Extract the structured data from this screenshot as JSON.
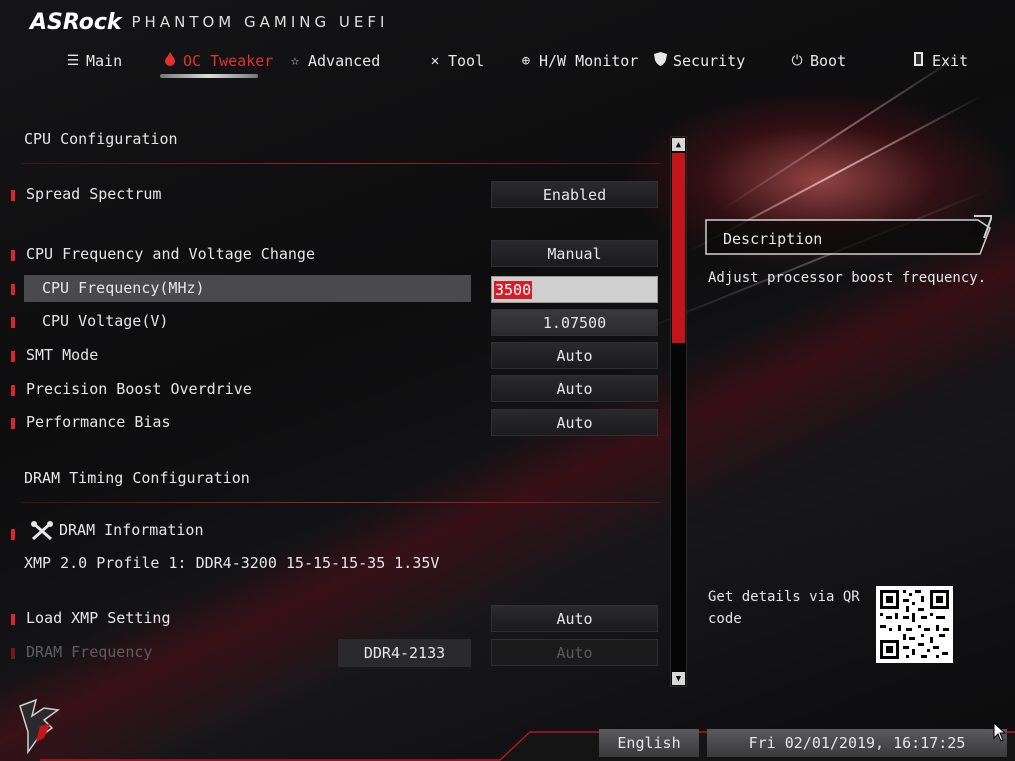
{
  "header": {
    "brand": "ASRock",
    "subtitle": "PHANTOM GAMING UEFI"
  },
  "nav": {
    "tabs": [
      {
        "label": "Main",
        "icon": "list-icon"
      },
      {
        "label": "OC Tweaker",
        "icon": "flame-icon",
        "active": true
      },
      {
        "label": "Advanced",
        "icon": "star-icon"
      },
      {
        "label": "Tool",
        "icon": "tools-icon"
      },
      {
        "label": "H/W Monitor",
        "icon": "crosshair-icon"
      },
      {
        "label": "Security",
        "icon": "shield-icon"
      },
      {
        "label": "Boot",
        "icon": "power-icon"
      },
      {
        "label": "Exit",
        "icon": "exit-door-icon"
      }
    ]
  },
  "cpu_section": {
    "title": "CPU Configuration",
    "rows": [
      {
        "label": "Spread Spectrum",
        "value": "Enabled"
      },
      {
        "label": "CPU Frequency and Voltage Change",
        "value": "Manual"
      },
      {
        "label": "CPU Frequency(MHz)",
        "value": "3500"
      },
      {
        "label": "CPU Voltage(V)",
        "value": "1.07500"
      },
      {
        "label": "SMT Mode",
        "value": "Auto"
      },
      {
        "label": "Precision Boost Overdrive",
        "value": "Auto"
      },
      {
        "label": "Performance Bias",
        "value": "Auto"
      }
    ]
  },
  "dram_section": {
    "title": "DRAM Timing Configuration",
    "info_label": "DRAM Information",
    "xmp_info": "XMP 2.0 Profile 1: DDR4-3200 15-15-15-35 1.35V",
    "load_xmp": {
      "label": "Load XMP Setting",
      "value": "Auto"
    },
    "dram_freq": {
      "label": "DRAM Frequency",
      "current": "DDR4-2133",
      "value": "Auto"
    }
  },
  "description": {
    "title": "Description",
    "text": "Adjust processor boost frequency."
  },
  "qr": {
    "text": "Get details via QR code"
  },
  "footer": {
    "language": "English",
    "datetime": "Fri 02/01/2019, 16:17:25"
  },
  "colors": {
    "accent": "#d8262a",
    "highlight_row": "#4a4a4c"
  }
}
